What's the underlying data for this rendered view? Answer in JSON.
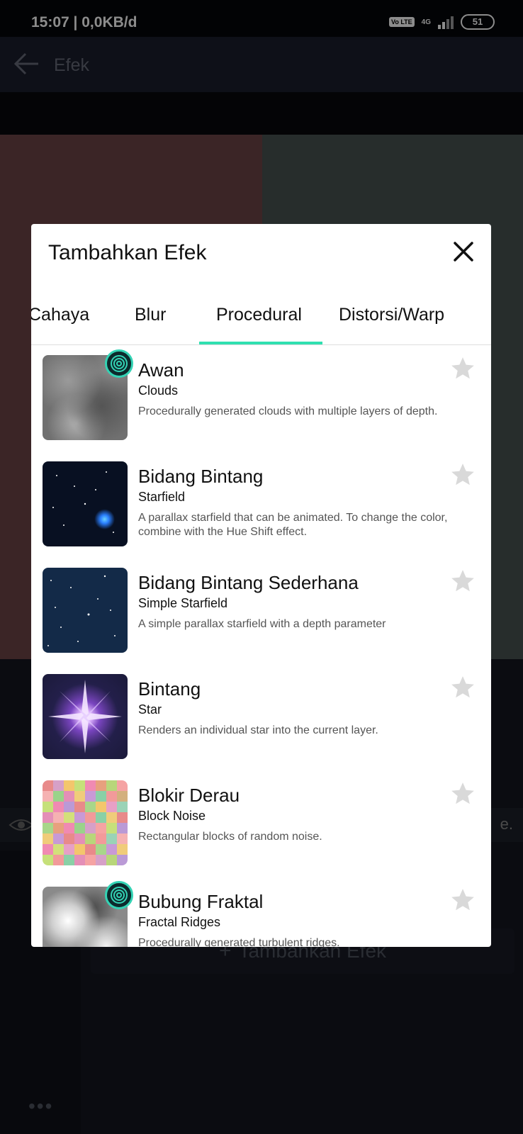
{
  "status_bar": {
    "time": "15:07 | 0,0KB/d",
    "volte": "Vo LTE",
    "network": "4G",
    "battery": "51"
  },
  "app_bar": {
    "title": "Efek"
  },
  "background": {
    "add_effect": "Tambahkan Efek",
    "clipped_text": "e."
  },
  "dialog": {
    "title": "Tambahkan Efek",
    "tabs": [
      {
        "label": "Cahaya"
      },
      {
        "label": "Blur"
      },
      {
        "label": "Procedural"
      },
      {
        "label": "Distorsi/Warp"
      }
    ],
    "selected_tab": "Procedural",
    "items": [
      {
        "title": "Awan",
        "subtitle": "Clouds",
        "description": "Procedurally generated clouds with multiple layers of depth.",
        "premium": true,
        "thumb": "clouds"
      },
      {
        "title": "Bidang Bintang",
        "subtitle": "Starfield",
        "description": "A parallax starfield that can be animated. To change the color, combine with the Hue Shift effect.",
        "premium": false,
        "thumb": "starfield"
      },
      {
        "title": "Bidang Bintang Sederhana",
        "subtitle": "Simple Starfield",
        "description": "A simple parallax starfield with a depth parameter",
        "premium": false,
        "thumb": "simple-starfield"
      },
      {
        "title": "Bintang",
        "subtitle": "Star",
        "description": "Renders an individual star into the current layer.",
        "premium": false,
        "thumb": "star"
      },
      {
        "title": "Blokir Derau",
        "subtitle": "Block Noise",
        "description": "Rectangular blocks of random noise.",
        "premium": false,
        "thumb": "block-noise"
      },
      {
        "title": "Bubung Fraktal",
        "subtitle": "Fractal Ridges",
        "description": "Procedurally generated turbulent ridges.",
        "premium": true,
        "thumb": "fractal-ridges"
      }
    ]
  },
  "colors": {
    "accent": "#2fe0b0",
    "dialog_bg": "#ffffff",
    "star_inactive": "#d9d9d9"
  }
}
